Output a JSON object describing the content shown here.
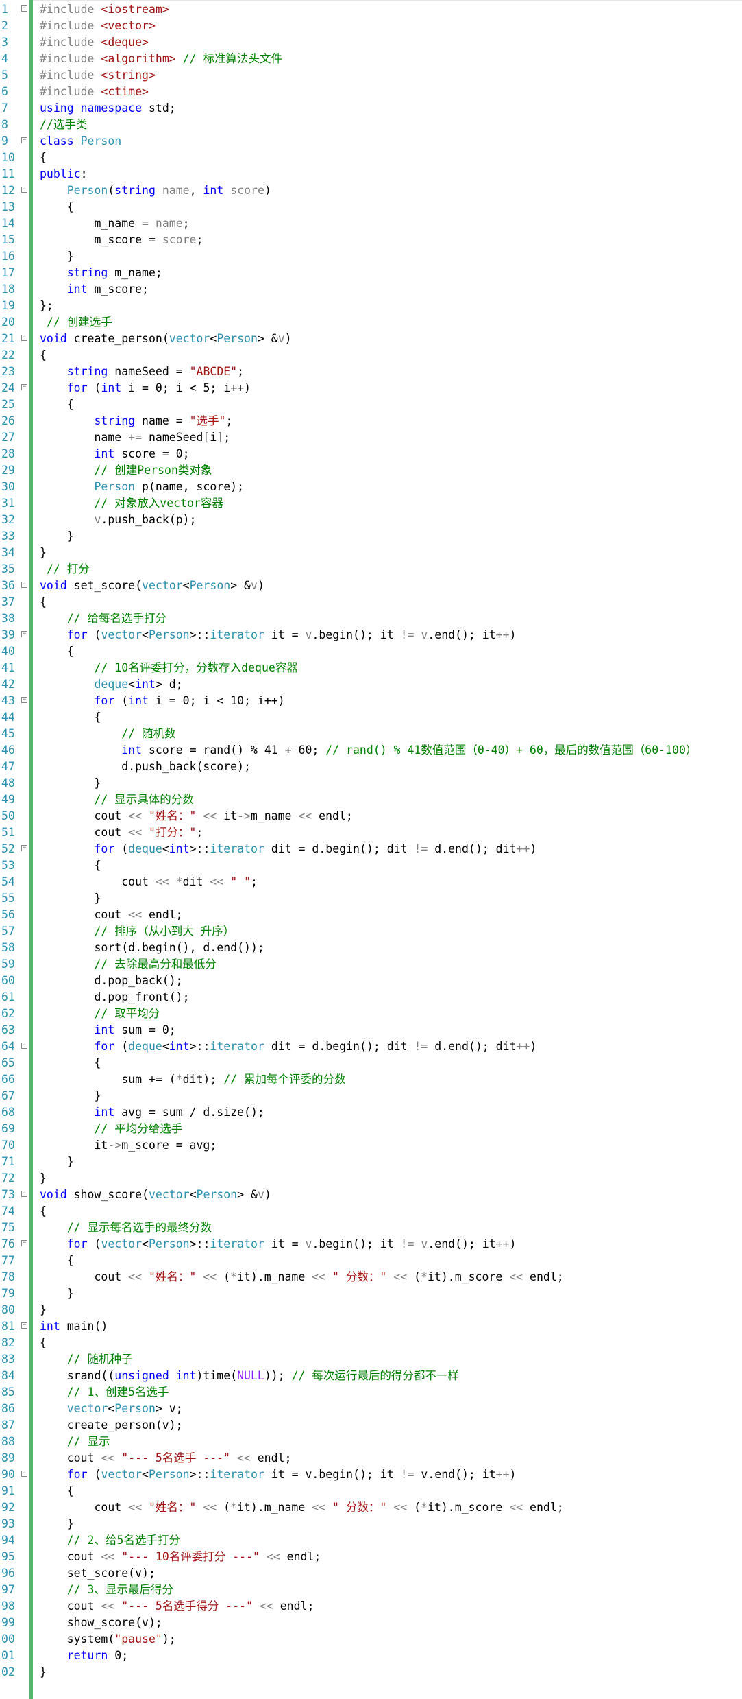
{
  "lines": [
    {
      "n": "1",
      "fold": true,
      "html": "<span class='p'>#include</span> <span class='s'>&lt;iostream&gt;</span>"
    },
    {
      "n": "2",
      "html": "<span class='p'>#include</span> <span class='s'>&lt;vector&gt;</span>"
    },
    {
      "n": "3",
      "html": "<span class='p'>#include</span> <span class='s'>&lt;deque&gt;</span>"
    },
    {
      "n": "4",
      "html": "<span class='p'>#include</span> <span class='s'>&lt;algorithm&gt;</span> <span class='c'>// 标准算法头文件</span>"
    },
    {
      "n": "5",
      "html": "<span class='p'>#include</span> <span class='s'>&lt;string&gt;</span>"
    },
    {
      "n": "6",
      "html": "<span class='p'>#include</span> <span class='s'>&lt;ctime&gt;</span>"
    },
    {
      "n": "7",
      "html": "<span class='k'>using namespace</span> std;"
    },
    {
      "n": "8",
      "html": "<span class='c'>//选手类</span>"
    },
    {
      "n": "9",
      "fold": true,
      "html": "<span class='k'>class</span> <span class='t'>Person</span>"
    },
    {
      "n": "10",
      "html": "{"
    },
    {
      "n": "11",
      "html": "<span class='k'>public</span>:"
    },
    {
      "n": "12",
      "fold": true,
      "html": "    <span class='t'>Person</span>(<span class='k'>string</span> <span class='v'>name</span>, <span class='k'>int</span> <span class='v'>score</span>)"
    },
    {
      "n": "13",
      "html": "    {"
    },
    {
      "n": "14",
      "html": "        m_name <span class='v'>=</span> <span class='v'>name</span>;"
    },
    {
      "n": "15",
      "html": "        m_score = <span class='v'>score</span>;"
    },
    {
      "n": "16",
      "html": "    }"
    },
    {
      "n": "17",
      "html": "    <span class='k'>string</span> m_name;"
    },
    {
      "n": "18",
      "html": "    <span class='k'>int</span> m_score;"
    },
    {
      "n": "19",
      "html": "};"
    },
    {
      "n": "20",
      "html": " <span class='c'>// 创建选手</span>"
    },
    {
      "n": "21",
      "fold": true,
      "html": "<span class='k'>void</span> create_person(<span class='t'>vector</span>&lt;<span class='t'>Person</span>&gt; &amp;<span class='v'>v</span>)"
    },
    {
      "n": "22",
      "html": "{"
    },
    {
      "n": "23",
      "html": "    <span class='k'>string</span> nameSeed = <span class='s'>\"ABCDE\"</span>;"
    },
    {
      "n": "24",
      "fold": true,
      "html": "    <span class='k'>for</span> (<span class='k'>int</span> i = 0; i &lt; 5; i++)"
    },
    {
      "n": "25",
      "html": "    {"
    },
    {
      "n": "26",
      "html": "        <span class='k'>string</span> name = <span class='s'>\"选手\"</span>;"
    },
    {
      "n": "27",
      "html": "        name <span class='v'>+=</span> nameSeed<span class='v'>[</span>i<span class='v'>]</span>;"
    },
    {
      "n": "28",
      "html": "        <span class='k'>int</span> score = 0;"
    },
    {
      "n": "29",
      "html": "        <span class='c'>// 创建Person类对象</span>"
    },
    {
      "n": "30",
      "html": "        <span class='t'>Person</span> p(name, score);"
    },
    {
      "n": "31",
      "html": "        <span class='c'>// 对象放入vector容器</span>"
    },
    {
      "n": "32",
      "html": "        <span class='v'>v</span>.push_back(p);"
    },
    {
      "n": "33",
      "html": "    }"
    },
    {
      "n": "34",
      "html": "}"
    },
    {
      "n": "35",
      "html": " <span class='c'>// 打分</span>"
    },
    {
      "n": "36",
      "fold": true,
      "html": "<span class='k'>void</span> set_score(<span class='t'>vector</span>&lt;<span class='t'>Person</span>&gt; &amp;<span class='v'>v</span>)"
    },
    {
      "n": "37",
      "html": "{"
    },
    {
      "n": "38",
      "html": "    <span class='c'>// 给每名选手打分</span>"
    },
    {
      "n": "39",
      "fold": true,
      "html": "    <span class='k'>for</span> (<span class='t'>vector</span>&lt;<span class='t'>Person</span>&gt;::<span class='t'>iterator</span> it = <span class='v'>v</span>.begin(); it <span class='v'>!=</span> <span class='v'>v</span>.end(); it<span class='v'>++</span>)"
    },
    {
      "n": "40",
      "html": "    {"
    },
    {
      "n": "41",
      "html": "        <span class='c'>// 10名评委打分，分数存入deque容器</span>"
    },
    {
      "n": "42",
      "html": "        <span class='t'>deque</span>&lt;<span class='k'>int</span>&gt; d;"
    },
    {
      "n": "43",
      "fold": true,
      "html": "        <span class='k'>for</span> (<span class='k'>int</span> i = 0; i &lt; 10; i++)"
    },
    {
      "n": "44",
      "html": "        {"
    },
    {
      "n": "45",
      "html": "            <span class='c'>// 随机数</span>"
    },
    {
      "n": "46",
      "html": "            <span class='k'>int</span> score = rand() % 41 + 60; <span class='c'>// rand() % 41数值范围（0-40）+ 60，最后的数值范围（60-100）</span>"
    },
    {
      "n": "47",
      "html": "            d.push_back(score);"
    },
    {
      "n": "48",
      "html": "        }"
    },
    {
      "n": "49",
      "html": "        <span class='c'>// 显示具体的分数</span>"
    },
    {
      "n": "50",
      "html": "        cout <span class='v'>&lt;&lt;</span> <span class='s'>\"姓名：\"</span> <span class='v'>&lt;&lt;</span> it<span class='v'>-&gt;</span>m_name <span class='v'>&lt;&lt;</span> endl;"
    },
    {
      "n": "51",
      "html": "        cout <span class='v'>&lt;&lt;</span> <span class='s'>\"打分：\"</span>;"
    },
    {
      "n": "52",
      "fold": true,
      "html": "        <span class='k'>for</span> (<span class='t'>deque</span>&lt;<span class='k'>int</span>&gt;::<span class='t'>iterator</span> dit = d.begin(); dit <span class='v'>!=</span> d.end(); dit<span class='v'>++</span>)"
    },
    {
      "n": "53",
      "html": "        {"
    },
    {
      "n": "54",
      "html": "            cout <span class='v'>&lt;&lt;</span> <span class='v'>*</span>dit <span class='v'>&lt;&lt;</span> <span class='s'>\" \"</span>;"
    },
    {
      "n": "55",
      "html": "        }"
    },
    {
      "n": "56",
      "html": "        cout <span class='v'>&lt;&lt;</span> endl;"
    },
    {
      "n": "57",
      "html": "        <span class='c'>// 排序（从小到大 升序）</span>"
    },
    {
      "n": "58",
      "html": "        sort(d.begin(), d.end());"
    },
    {
      "n": "59",
      "html": "        <span class='c'>// 去除最高分和最低分</span>"
    },
    {
      "n": "60",
      "html": "        d.pop_back();"
    },
    {
      "n": "61",
      "html": "        d.pop_front();"
    },
    {
      "n": "62",
      "html": "        <span class='c'>// 取平均分</span>"
    },
    {
      "n": "63",
      "html": "        <span class='k'>int</span> sum = 0;"
    },
    {
      "n": "64",
      "fold": true,
      "html": "        <span class='k'>for</span> (<span class='t'>deque</span>&lt;<span class='k'>int</span>&gt;::<span class='t'>iterator</span> dit = d.begin(); dit <span class='v'>!=</span> d.end(); dit<span class='v'>++</span>)"
    },
    {
      "n": "65",
      "html": "        {"
    },
    {
      "n": "66",
      "html": "            sum += (<span class='v'>*</span>dit); <span class='c'>// 累加每个评委的分数</span>"
    },
    {
      "n": "67",
      "html": "        }"
    },
    {
      "n": "68",
      "html": "        <span class='k'>int</span> avg = sum / d.size();"
    },
    {
      "n": "69",
      "html": "        <span class='c'>// 平均分给选手</span>"
    },
    {
      "n": "70",
      "html": "        it<span class='v'>-&gt;</span>m_score = avg;"
    },
    {
      "n": "71",
      "html": "    }"
    },
    {
      "n": "72",
      "html": "}"
    },
    {
      "n": "73",
      "fold": true,
      "html": "<span class='k'>void</span> show_score(<span class='t'>vector</span>&lt;<span class='t'>Person</span>&gt; &amp;<span class='v'>v</span>)"
    },
    {
      "n": "74",
      "html": "{"
    },
    {
      "n": "75",
      "html": "    <span class='c'>// 显示每名选手的最终分数</span>"
    },
    {
      "n": "76",
      "fold": true,
      "html": "    <span class='k'>for</span> (<span class='t'>vector</span>&lt;<span class='t'>Person</span>&gt;::<span class='t'>iterator</span> it = <span class='v'>v</span>.begin(); it <span class='v'>!=</span> <span class='v'>v</span>.end(); it<span class='v'>++</span>)"
    },
    {
      "n": "77",
      "html": "    {"
    },
    {
      "n": "78",
      "html": "        cout <span class='v'>&lt;&lt;</span> <span class='s'>\"姓名：\"</span> <span class='v'>&lt;&lt;</span> (<span class='v'>*</span>it).m_name <span class='v'>&lt;&lt;</span> <span class='s'>\" 分数：\"</span> <span class='v'>&lt;&lt;</span> (<span class='v'>*</span>it).m_score <span class='v'>&lt;&lt;</span> endl;"
    },
    {
      "n": "79",
      "html": "    }"
    },
    {
      "n": "80",
      "html": "}"
    },
    {
      "n": "81",
      "fold": true,
      "html": "<span class='k'>int</span> main()"
    },
    {
      "n": "82",
      "html": "{"
    },
    {
      "n": "83",
      "html": "    <span class='c'>// 随机种子</span>"
    },
    {
      "n": "84",
      "html": "    srand((<span class='k'>unsigned int</span>)time(<span class='m'>NULL</span>)); <span class='c'>// 每次运行最后的得分都不一样</span>"
    },
    {
      "n": "85",
      "html": "    <span class='c'>// 1、创建5名选手</span>"
    },
    {
      "n": "86",
      "html": "    <span class='t'>vector</span>&lt;<span class='t'>Person</span>&gt; v;"
    },
    {
      "n": "87",
      "html": "    create_person(v);"
    },
    {
      "n": "88",
      "html": "    <span class='c'>// 显示</span>"
    },
    {
      "n": "89",
      "html": "    cout <span class='v'>&lt;&lt;</span> <span class='s'>\"--- 5名选手 ---\"</span> <span class='v'>&lt;&lt;</span> endl;"
    },
    {
      "n": "90",
      "fold": true,
      "html": "    <span class='k'>for</span> (<span class='t'>vector</span>&lt;<span class='t'>Person</span>&gt;::<span class='t'>iterator</span> it = v.begin(); it <span class='v'>!=</span> v.end(); it<span class='v'>++</span>)"
    },
    {
      "n": "91",
      "html": "    {"
    },
    {
      "n": "92",
      "html": "        cout <span class='v'>&lt;&lt;</span> <span class='s'>\"姓名：\"</span> <span class='v'>&lt;&lt;</span> (<span class='v'>*</span>it).m_name <span class='v'>&lt;&lt;</span> <span class='s'>\" 分数：\"</span> <span class='v'>&lt;&lt;</span> (<span class='v'>*</span>it).m_score <span class='v'>&lt;&lt;</span> endl;"
    },
    {
      "n": "93",
      "html": "    }"
    },
    {
      "n": "94",
      "html": "    <span class='c'>// 2、给5名选手打分</span>"
    },
    {
      "n": "95",
      "html": "    cout <span class='v'>&lt;&lt;</span> <span class='s'>\"--- 10名评委打分 ---\"</span> <span class='v'>&lt;&lt;</span> endl;"
    },
    {
      "n": "96",
      "html": "    set_score(v);"
    },
    {
      "n": "97",
      "html": "    <span class='c'>// 3、显示最后得分</span>"
    },
    {
      "n": "98",
      "html": "    cout <span class='v'>&lt;&lt;</span> <span class='s'>\"--- 5名选手得分 ---\"</span> <span class='v'>&lt;&lt;</span> endl;"
    },
    {
      "n": "99",
      "html": "    show_score(v);"
    },
    {
      "n": "00",
      "html": "    system(<span class='s'>\"pause\"</span>);"
    },
    {
      "n": "01",
      "html": "    <span class='k'>return</span> 0;"
    },
    {
      "n": "02",
      "html": "}"
    }
  ]
}
